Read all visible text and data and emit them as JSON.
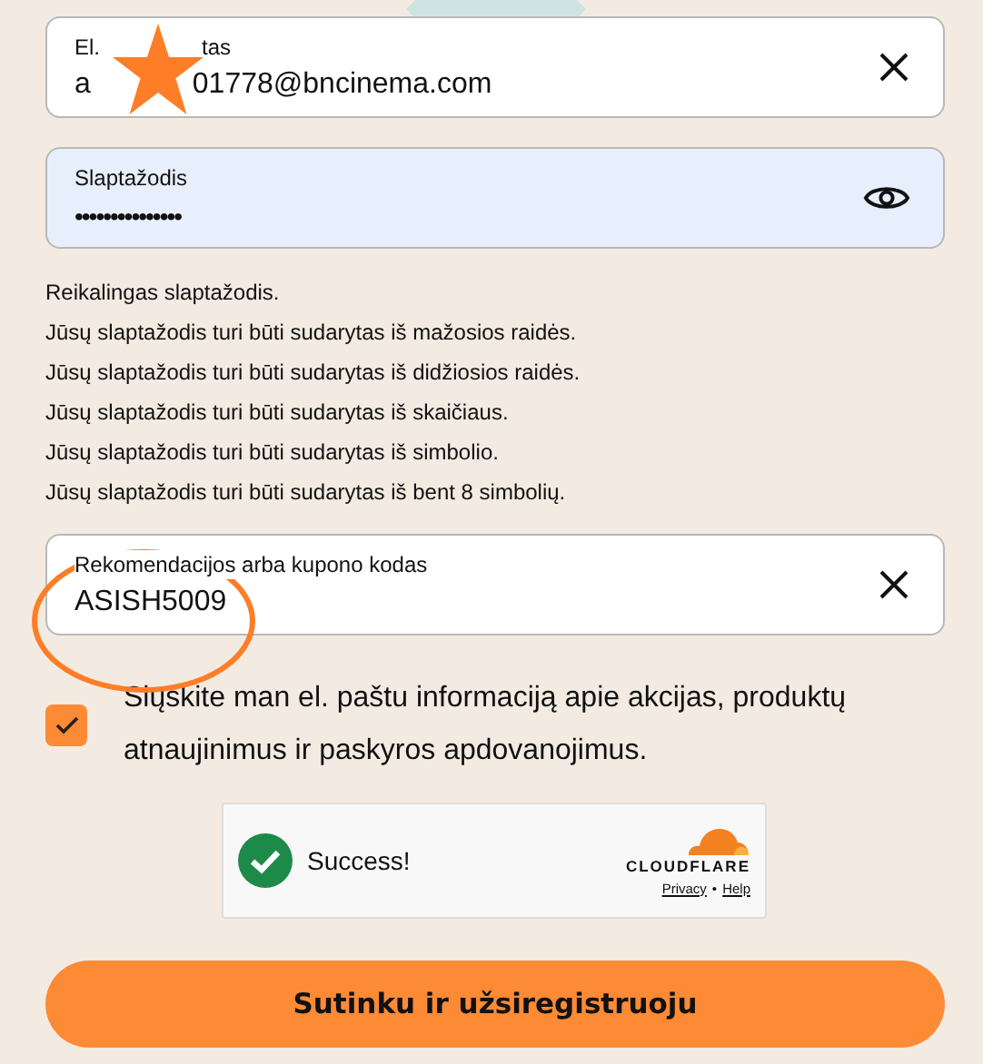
{
  "email_field": {
    "label_parts": [
      "El.",
      "tas"
    ],
    "value_parts": [
      "a",
      "01778@bncinema.com"
    ]
  },
  "password_field": {
    "label": "Slaptažodis",
    "value": "•••••••••••••••",
    "focused": true
  },
  "messages": [
    "Reikalingas slaptažodis.",
    "Jūsų slaptažodis turi būti sudarytas iš mažosios raidės.",
    "Jūsų slaptažodis turi būti sudarytas iš didžiosios raidės.",
    "Jūsų slaptažodis turi būti sudarytas iš skaičiaus.",
    "Jūsų slaptažodis turi būti sudarytas iš simbolio.",
    "Jūsų slaptažodis turi būti sudarytas iš bent 8 simbolių."
  ],
  "code_field": {
    "label": "Rekomendacijos arba kupono kodas",
    "value": "ASISH5009"
  },
  "newsletter": {
    "label": "Siųskite man el. paštu informaciją apie akcijas, produktų atnaujinimus ir paskyros apdovanojimus.",
    "checked": true
  },
  "captcha": {
    "status": "Success!",
    "brand": "CLOUDFLARE",
    "links": [
      "Privacy",
      "Help"
    ],
    "separator": "•"
  },
  "submit_button": "Sutinku ir užsiregistruoju"
}
